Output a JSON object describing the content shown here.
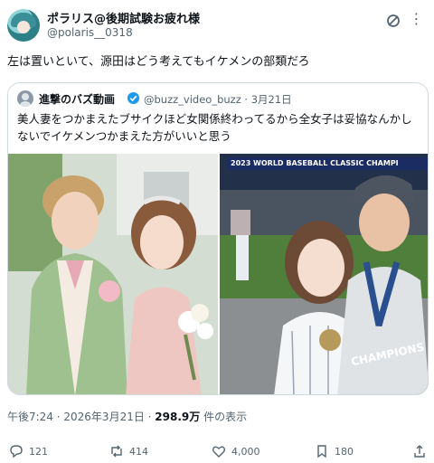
{
  "author": {
    "display_name": "ポラリス@後期試験お疲れ様",
    "handle": "@polaris__0318"
  },
  "tweet": {
    "text": "左は置いといて、源田はどう考えてもイケメンの部類だろ"
  },
  "quote": {
    "name": "進撃のバズ動画",
    "handle_date": "@buzz_video_buzz · 3月21日",
    "text": "美人妻をつかまえたブサイクほど女関係終わってるから全女子は妥協なんかしないでイケメンつかまえた方がいいと思う",
    "photo_banner": "2023 WORLD BASEBALL CLASSIC CHAMPI",
    "photo_champions": "CHAMPIONS"
  },
  "meta": {
    "time_date": "午後7:24 · 2026年3月21日 · ",
    "views_count": "298.9万",
    "views_label": " 件の表示"
  },
  "actions": {
    "replies": "121",
    "reposts": "414",
    "likes": "4,000",
    "bookmarks": "180"
  },
  "colors": {
    "accent": "#1d9bf0",
    "secondary_text": "#536471",
    "border": "#cfd9de"
  },
  "icons": [
    "grok-icon",
    "more-icon",
    "verified-icon",
    "reply-icon",
    "repost-icon",
    "like-icon",
    "bookmark-icon",
    "share-icon"
  ]
}
